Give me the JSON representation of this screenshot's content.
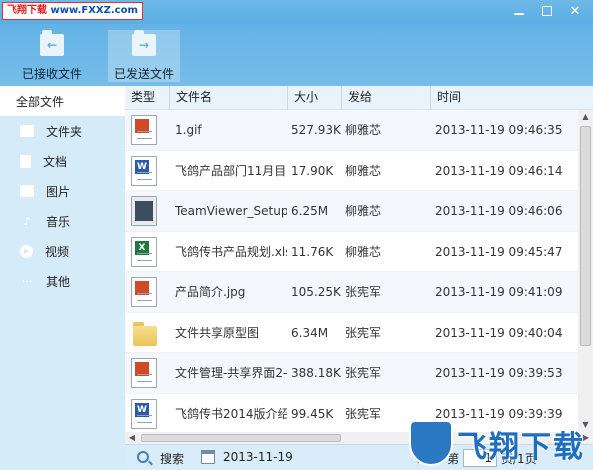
{
  "brand": {
    "logo_text": "飞翔下载",
    "logo_url": "www.FXXZ.com"
  },
  "window": {
    "close": "✕"
  },
  "toolbar": {
    "received_label": "已接收文件",
    "sent_label": "已发送文件"
  },
  "sidebar": {
    "items": [
      {
        "label": "全部文件",
        "icon": "none"
      },
      {
        "label": "文件夹",
        "icon": "folder-icon"
      },
      {
        "label": "文档",
        "icon": "document-icon"
      },
      {
        "label": "图片",
        "icon": "image-icon"
      },
      {
        "label": "音乐",
        "icon": "music-icon"
      },
      {
        "label": "视频",
        "icon": "video-icon"
      },
      {
        "label": "其他",
        "icon": "more-icon"
      }
    ]
  },
  "table": {
    "columns": [
      "类型",
      "文件名",
      "大小",
      "发给",
      "时间"
    ],
    "rows": [
      {
        "type": "image",
        "name": "1.gif",
        "size": "527.93K",
        "to": "柳雅芯",
        "time": "2013-11-19 09:46:35"
      },
      {
        "type": "word",
        "name": "飞鸽产品部门11月目",
        "size": "17.90K",
        "to": "柳雅芯",
        "time": "2013-11-19 09:46:14"
      },
      {
        "type": "exe",
        "name": "TeamViewer_Setup.",
        "size": "6.25M",
        "to": "柳雅芯",
        "time": "2013-11-19 09:46:06"
      },
      {
        "type": "excel",
        "name": "飞鸽传书产品规划.xls",
        "size": "11.76K",
        "to": "柳雅芯",
        "time": "2013-11-19 09:45:47"
      },
      {
        "type": "image",
        "name": "产品简介.jpg",
        "size": "105.25K",
        "to": "张宪军",
        "time": "2013-11-19 09:41:09"
      },
      {
        "type": "folder",
        "name": "文件共享原型图",
        "size": "6.34M",
        "to": "张宪军",
        "time": "2013-11-19 09:40:04"
      },
      {
        "type": "image",
        "name": "文件管理-共享界面2-",
        "size": "388.18K",
        "to": "张宪军",
        "time": "2013-11-19 09:39:53"
      },
      {
        "type": "word",
        "name": "飞鸽传书2014版介绍",
        "size": "99.45K",
        "to": "张宪军",
        "time": "2013-11-19 09:39:39"
      }
    ]
  },
  "status": {
    "search_label": "搜索",
    "date": "2013-11-19",
    "page_prefix": "第",
    "page_value": "1",
    "page_suffix": "页/1页"
  },
  "watermark": {
    "text": "飞翔下载"
  }
}
